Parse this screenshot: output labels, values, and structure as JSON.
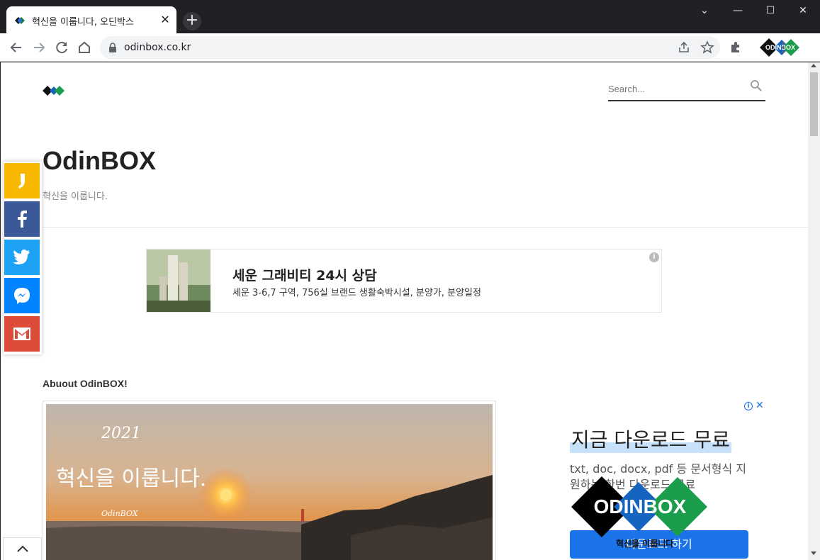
{
  "browser": {
    "tab_title": "혁신을 이룹니다, 오딘박스",
    "tab_close": "✕",
    "new_tab": "+",
    "url": "odinbox.co.kr",
    "window_controls": {
      "dropdown": "⌄",
      "minimize": "—",
      "maximize": "☐",
      "close": "✕"
    },
    "profile_logo_text": "ODINBOX"
  },
  "page": {
    "site_title": "OdinBOX",
    "tagline": "혁신을 이룹니다.",
    "search_placeholder": "Search..."
  },
  "ad_banner": {
    "title": "세운 그래비티 24시 상담",
    "description": "세운 3-6,7 구역, 756실 브랜드 생활숙박시설, 분양가, 분양일정",
    "info": "i"
  },
  "about": {
    "heading": "Abuout OdinBOX!",
    "image_text_year": "2021",
    "image_text_slogan": "혁신을 이룹니다.",
    "image_text_brand": "OdinBOX"
  },
  "side_ad": {
    "info": "i",
    "close": "✕",
    "headline": "지금 다운로드 무료",
    "body": "txt, doc, docx, pdf 등 문서형식 지원하는 한번 다운로드 무료",
    "cta": "다운로드 하기",
    "overlay_brand": "ODINBOX",
    "overlay_caption": "혁신을 이룹니다"
  },
  "share": {
    "items": [
      {
        "name": "kakao-story",
        "color": "#f9b800"
      },
      {
        "name": "facebook",
        "color": "#3b5998"
      },
      {
        "name": "twitter",
        "color": "#1da1f2"
      },
      {
        "name": "messenger",
        "color": "#0084ff"
      },
      {
        "name": "gmail",
        "color": "#dd4b39"
      }
    ]
  },
  "back_to_top": "^"
}
